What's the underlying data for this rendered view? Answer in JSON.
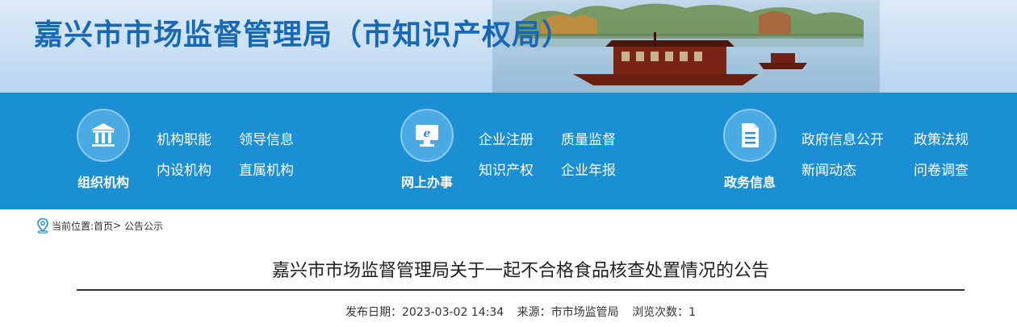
{
  "site": {
    "title": "嘉兴市市场监督管理局（市知识产权局）"
  },
  "nav": {
    "groups": [
      {
        "label": "组织机构",
        "icon": "institution-icon",
        "links": [
          "机构职能",
          "领导信息",
          "内设机构",
          "直属机构"
        ]
      },
      {
        "label": "网上办事",
        "icon": "online-service-icon",
        "links": [
          "企业注册",
          "质量监督",
          "知识产权",
          "企业年报"
        ]
      },
      {
        "label": "政务信息",
        "icon": "document-icon",
        "links": [
          "政府信息公开",
          "政策法规",
          "新闻动态",
          "问卷调查"
        ]
      }
    ]
  },
  "breadcrumb": {
    "prefix": "当前位置:",
    "home": "首页",
    "separator": "> ",
    "current": "公告公示"
  },
  "article": {
    "title": "嘉兴市市场监督管理局关于一起不合格食品核查处置情况的公告",
    "publish_date_label": "发布日期：",
    "publish_date": "2023-03-02 14:34",
    "source_label": "来源：",
    "source": "市市场监管局",
    "views_label": "浏览次数：",
    "views": "1"
  },
  "colors": {
    "nav_background": "#1a8fd3",
    "title_blue": "#1769b5"
  }
}
